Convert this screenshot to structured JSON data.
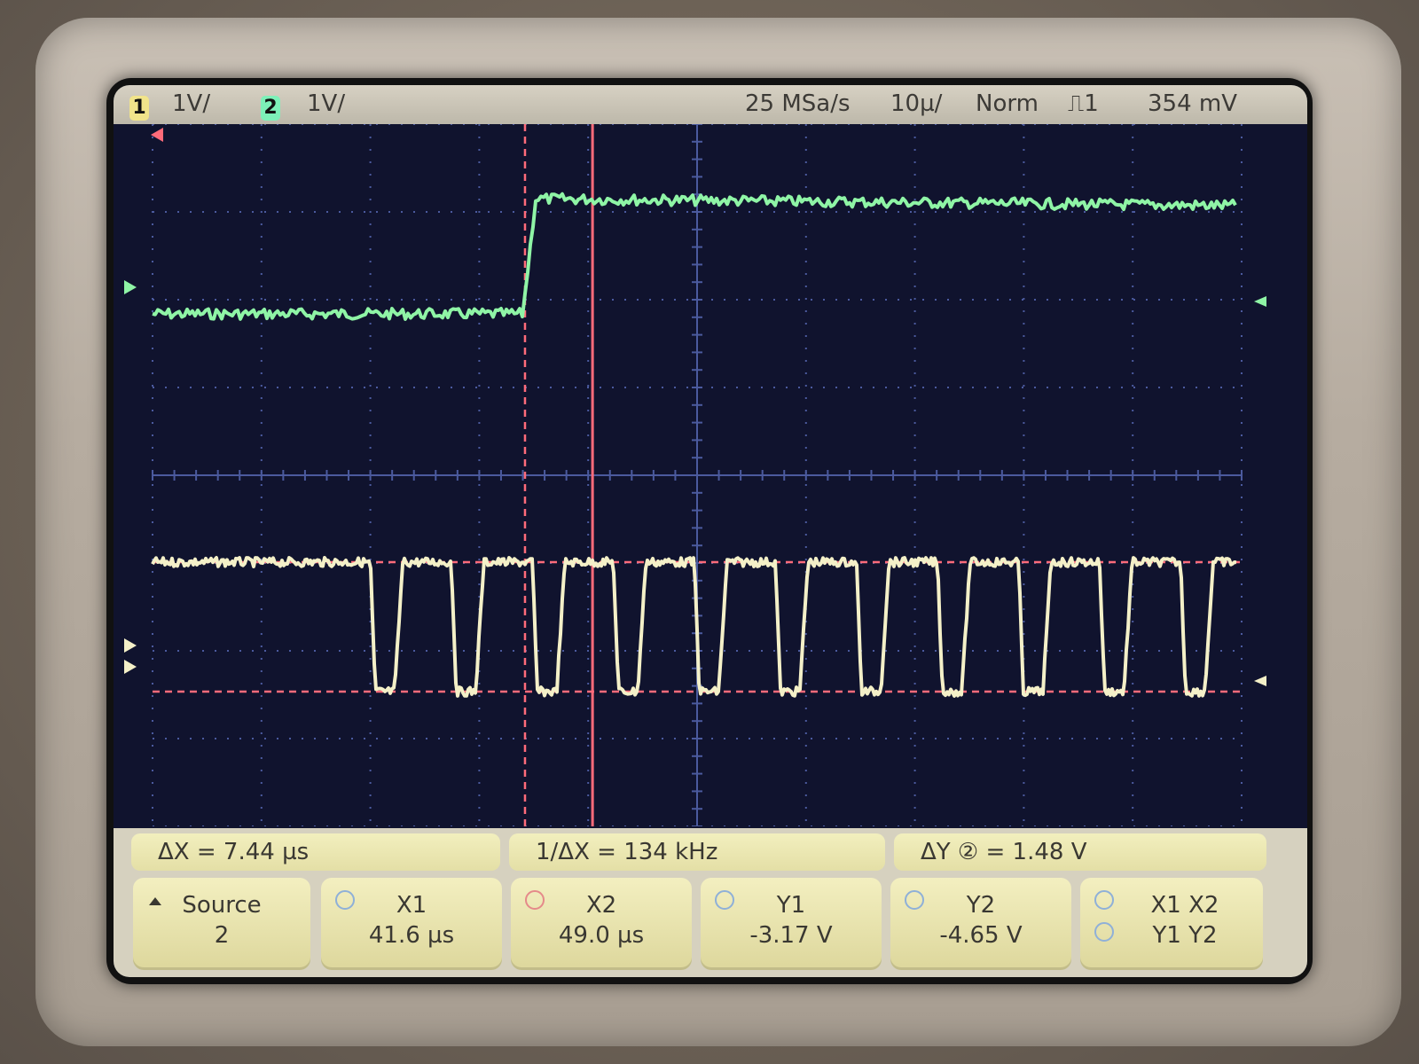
{
  "status_bar": {
    "ch1_number": "1",
    "ch1_scale": "1V/",
    "ch2_number": "2",
    "ch2_scale": "1V/",
    "sample_rate": "25 MSa/s",
    "timebase": "10µ/",
    "trigger_mode": "Norm",
    "trigger_edge": "⎍1",
    "trigger_level": "354 mV"
  },
  "measurements": {
    "delta_x": "ΔX = 7.44 µs",
    "inverse_delta_x": "1/ΔX = 134 kHz",
    "delta_y": "ΔY ② = 1.48 V"
  },
  "softkeys": {
    "source_label": "Source",
    "source_value": "2",
    "x1_label": "X1",
    "x1_value": "41.6 µs",
    "x2_label": "X2",
    "x2_value": "49.0 µs",
    "y1_label": "Y1",
    "y1_value": "-3.17 V",
    "y2_label": "Y2",
    "y2_value": "-4.65 V",
    "pair_top": "X1  X2",
    "pair_bottom": "Y1  Y2"
  },
  "colors": {
    "screen_bg": "#10132e",
    "grid": "#4b5a9e",
    "ch1_trace": "#f4f0c8",
    "ch2_trace": "#8ff5a6",
    "cursor": "#ff6b7a"
  },
  "traces": {
    "ch1_period_us": 7.44,
    "ch1_burst_start_div": 2.0,
    "ch2_step_div": 3.4
  }
}
